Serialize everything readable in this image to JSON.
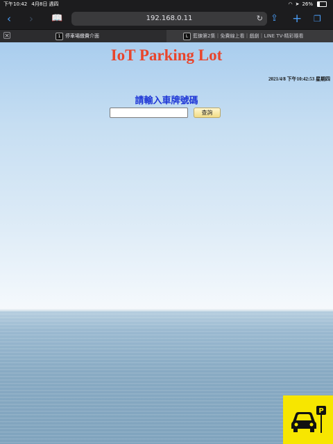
{
  "status_bar": {
    "time": "下午10:42",
    "date": "4月8日 週四",
    "battery": "26%"
  },
  "browser": {
    "address": "192.168.0.11",
    "tabs": [
      {
        "label": "停車場繳費介面",
        "favicon": "1",
        "active": true
      },
      {
        "label": "藍鍊第2集｜免費線上看｜戲劇｜LINE TV-精彩隨看",
        "favicon": "L",
        "active": false
      }
    ],
    "icons": [
      "back-icon",
      "forward-icon",
      "bookmarks-icon",
      "reload-icon",
      "share-icon",
      "new-tab-icon",
      "tabs-icon"
    ]
  },
  "page": {
    "title": "IoT Parking Lot",
    "datetime": "2021/4/8 下午10:42:53 星期四",
    "prompt": "請輸入車牌號碼",
    "input_value": "",
    "query_button": "查詢",
    "colors": {
      "title": "#e8452c",
      "prompt": "#1d35d6",
      "widget_bg": "#f7e600"
    },
    "widget_icon": "car-parking-icon",
    "widget_sign": "P"
  }
}
